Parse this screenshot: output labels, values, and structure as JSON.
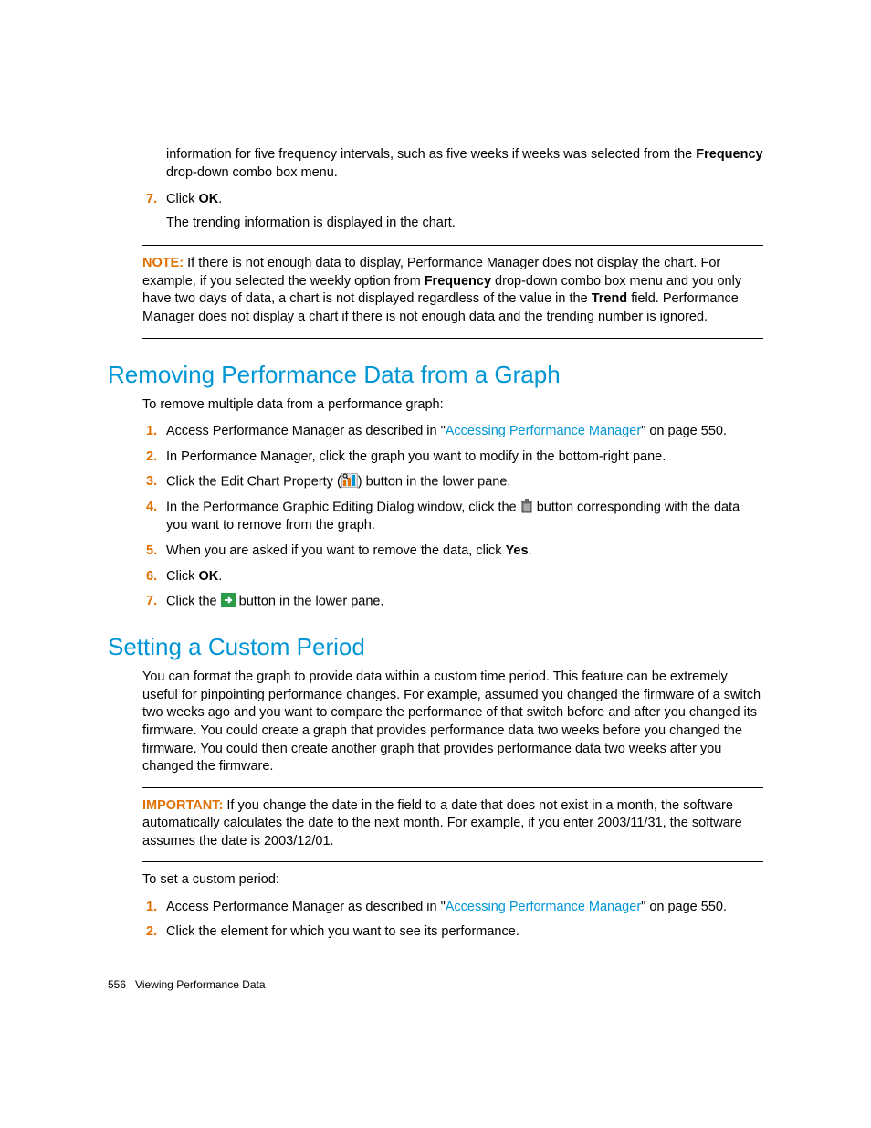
{
  "intro": {
    "continuation_before": "information for five frequency intervals, such as five weeks if weeks was selected from the ",
    "frequency_bold": "Frequency",
    "continuation_after": " drop-down combo box menu."
  },
  "step7a": {
    "num": "7.",
    "pre": "Click ",
    "ok": "OK",
    "post": ".",
    "sub": "The trending information is displayed in the chart."
  },
  "note": {
    "label": "NOTE:",
    "t1": "   If there is not enough data to display, Performance Manager does not display the chart. For example, if you selected the weekly option from ",
    "freq": "Frequency",
    "t2": " drop-down combo box menu and you only have two days of data, a chart is not displayed regardless of the value in the ",
    "trend": "Trend",
    "t3": " field. Performance Manager does not display a chart if there is not enough data and the trending number is ignored."
  },
  "heading1": "Removing Performance Data from a Graph",
  "removing_intro": "To remove multiple data from a performance graph:",
  "rs1": {
    "num": "1.",
    "pre": "Access Performance Manager as described in \"",
    "link": "Accessing Performance Manager",
    "post": "\" on page 550."
  },
  "rs2": {
    "num": "2.",
    "text": "In Performance Manager, click the graph you want to modify in the bottom-right pane."
  },
  "rs3": {
    "num": "3.",
    "pre": "Click the Edit Chart Property (",
    "post": ") button in the lower pane."
  },
  "rs4": {
    "num": "4.",
    "pre": "In the Performance Graphic Editing Dialog window, click the ",
    "post": " button corresponding with the data you want to remove from the graph."
  },
  "rs5": {
    "num": "5.",
    "pre": "When you are asked if you want to remove the data, click ",
    "yes": "Yes",
    "post": "."
  },
  "rs6": {
    "num": "6.",
    "pre": "Click ",
    "ok": "OK",
    "post": "."
  },
  "rs7": {
    "num": "7.",
    "pre": "Click the ",
    "post": " button in the lower pane."
  },
  "heading2": "Setting a Custom Period",
  "custom_intro": "You can format the graph to provide data within a custom time period. This feature can be extremely useful for pinpointing performance changes. For example, assumed you changed the firmware of a switch two weeks ago and you want to compare the performance of that switch before and after you changed its firmware. You could create a graph that provides performance data two weeks before you changed the firmware. You could then create another graph that provides performance data two weeks after you changed the firmware.",
  "important": {
    "label": "IMPORTANT:",
    "text": "   If you change the date in the field to a date that does not exist in a month, the software automatically calculates the date to the next month. For example, if you enter 2003/11/31, the software assumes the date is 2003/12/01."
  },
  "custom_lead": "To set a custom period:",
  "cs1": {
    "num": "1.",
    "pre": "Access Performance Manager as described in \"",
    "link": "Accessing Performance Manager",
    "post": "\" on page 550."
  },
  "cs2": {
    "num": "2.",
    "text": "Click the element for which you want to see its performance."
  },
  "footer": {
    "page": "556",
    "title": "Viewing Performance Data"
  }
}
